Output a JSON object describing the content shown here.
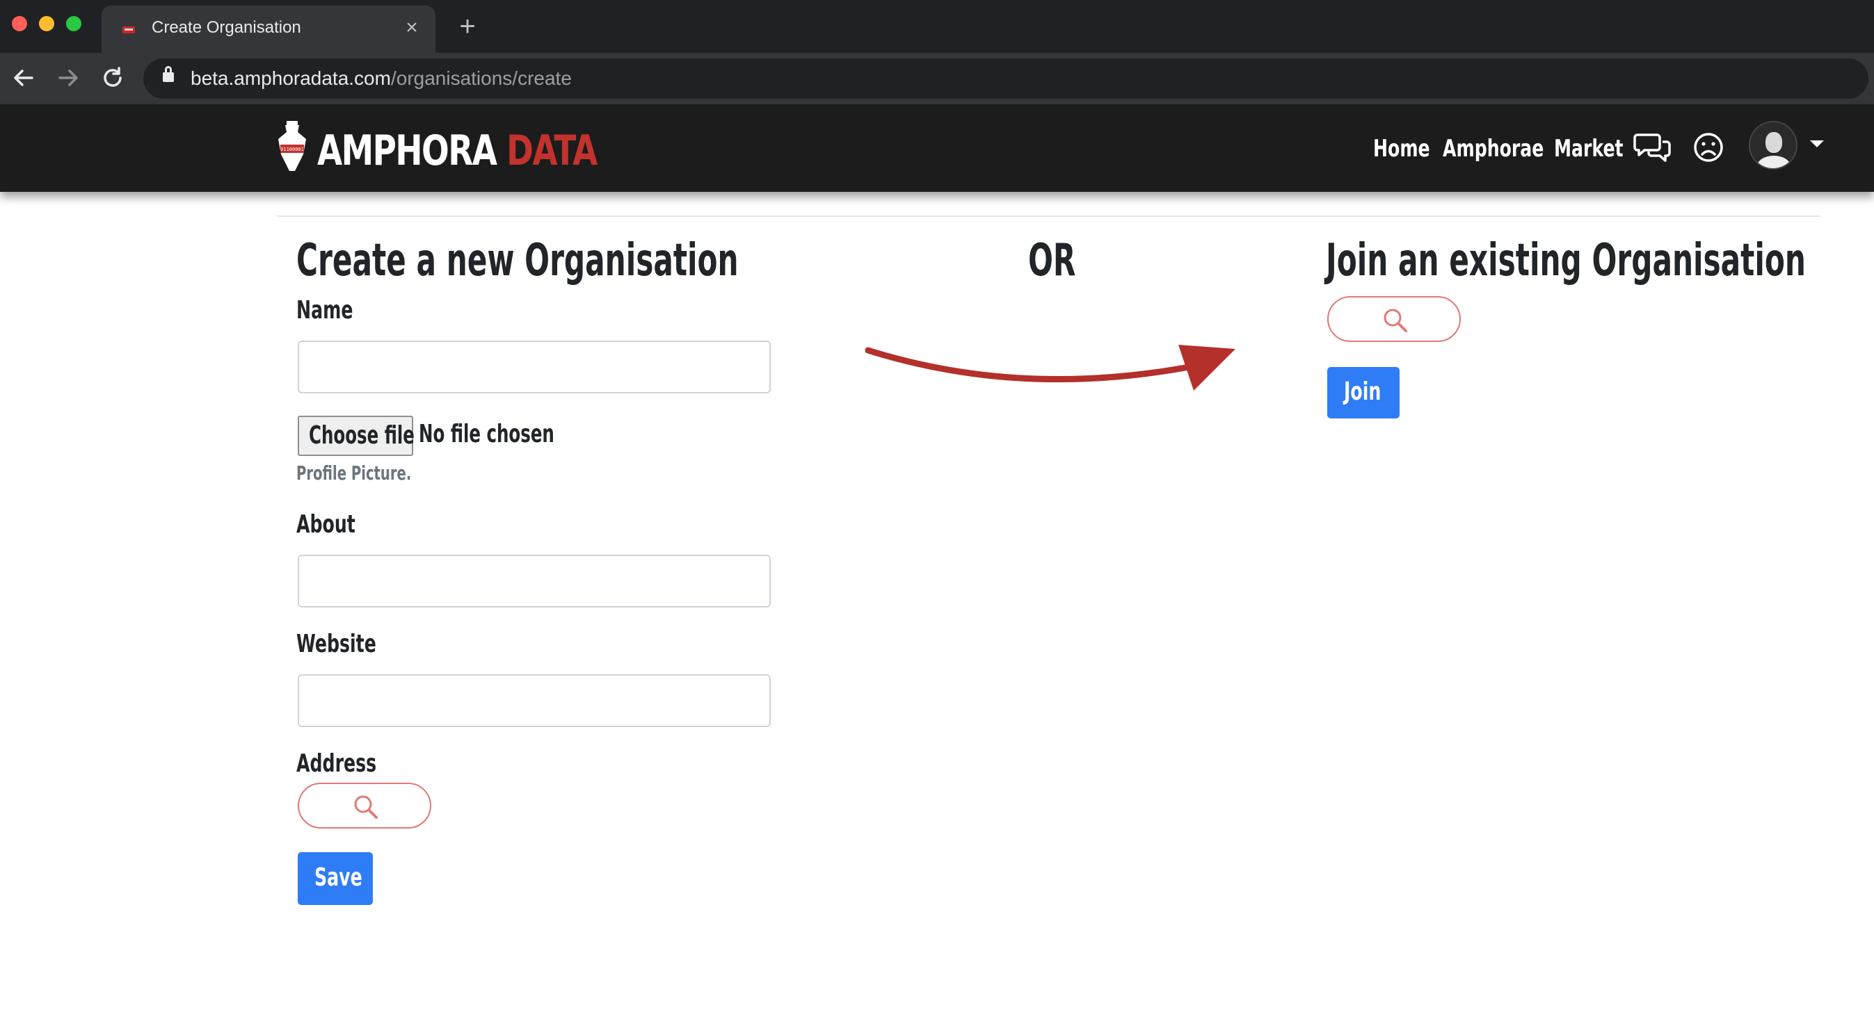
{
  "browser": {
    "tab_title": "Create Organisation",
    "tab_close": "×",
    "new_tab": "+",
    "url_host": "beta.amphoradata.com",
    "url_path": "/organisations/create"
  },
  "navbar": {
    "logo_amphora": "AMPHORA",
    "logo_data": "DATA",
    "logo_vase_text": "01100001",
    "links": [
      "Home",
      "Amphorae",
      "Market"
    ],
    "icons": [
      "chat-icon",
      "face-icon",
      "avatar",
      "caret-down-icon"
    ]
  },
  "create": {
    "heading": "Create a new Organisation",
    "name_label": "Name",
    "file_button": "Choose file",
    "file_status": "No file chosen",
    "file_help": "Profile Picture.",
    "about_label": "About",
    "website_label": "Website",
    "address_label": "Address",
    "save_label": "Save"
  },
  "or_label": "OR",
  "join": {
    "heading": "Join an existing Organisation",
    "join_label": "Join"
  },
  "colors": {
    "brand_red": "#c3322c",
    "primary_blue": "#2f7df6",
    "navbar_bg": "#1c1c1c",
    "search_border": "#e07a75"
  }
}
